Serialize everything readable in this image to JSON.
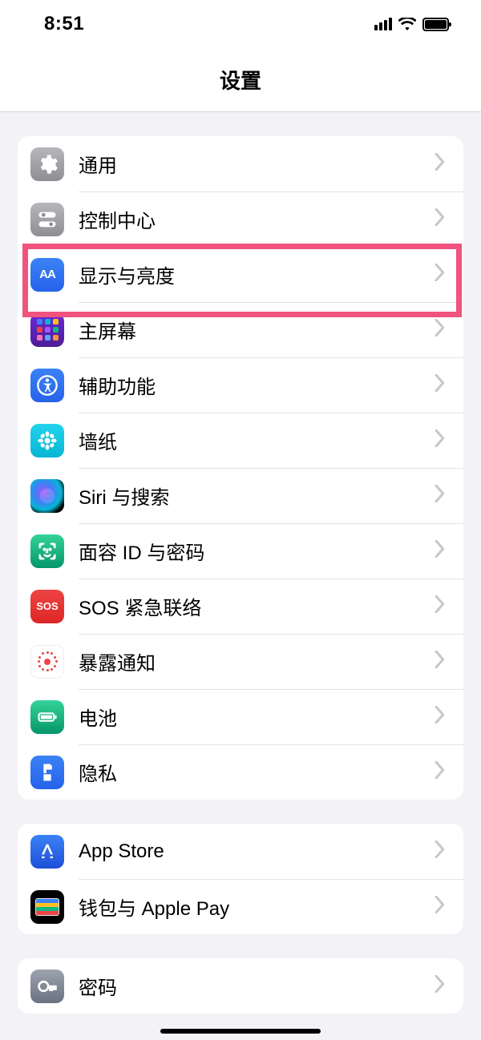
{
  "status_bar": {
    "time": "8:51"
  },
  "header": {
    "title": "设置"
  },
  "groups": [
    {
      "items": [
        {
          "icon": "gear",
          "label": "通用"
        },
        {
          "icon": "ctrl",
          "label": "控制中心"
        },
        {
          "icon": "disp",
          "label": "显示与亮度",
          "highlighted": true
        },
        {
          "icon": "home",
          "label": "主屏幕"
        },
        {
          "icon": "acc",
          "label": "辅助功能"
        },
        {
          "icon": "wall",
          "label": "墙纸"
        },
        {
          "icon": "siri",
          "label": "Siri 与搜索"
        },
        {
          "icon": "face",
          "label": "面容 ID 与密码"
        },
        {
          "icon": "sos",
          "label": "SOS 紧急联络"
        },
        {
          "icon": "expo",
          "label": "暴露通知"
        },
        {
          "icon": "bat-i",
          "label": "电池"
        },
        {
          "icon": "priv",
          "label": "隐私"
        }
      ]
    },
    {
      "items": [
        {
          "icon": "astore",
          "label": "App Store"
        },
        {
          "icon": "wllt",
          "label": "钱包与 Apple Pay"
        }
      ]
    },
    {
      "items": [
        {
          "icon": "pw",
          "label": "密码"
        }
      ]
    }
  ]
}
